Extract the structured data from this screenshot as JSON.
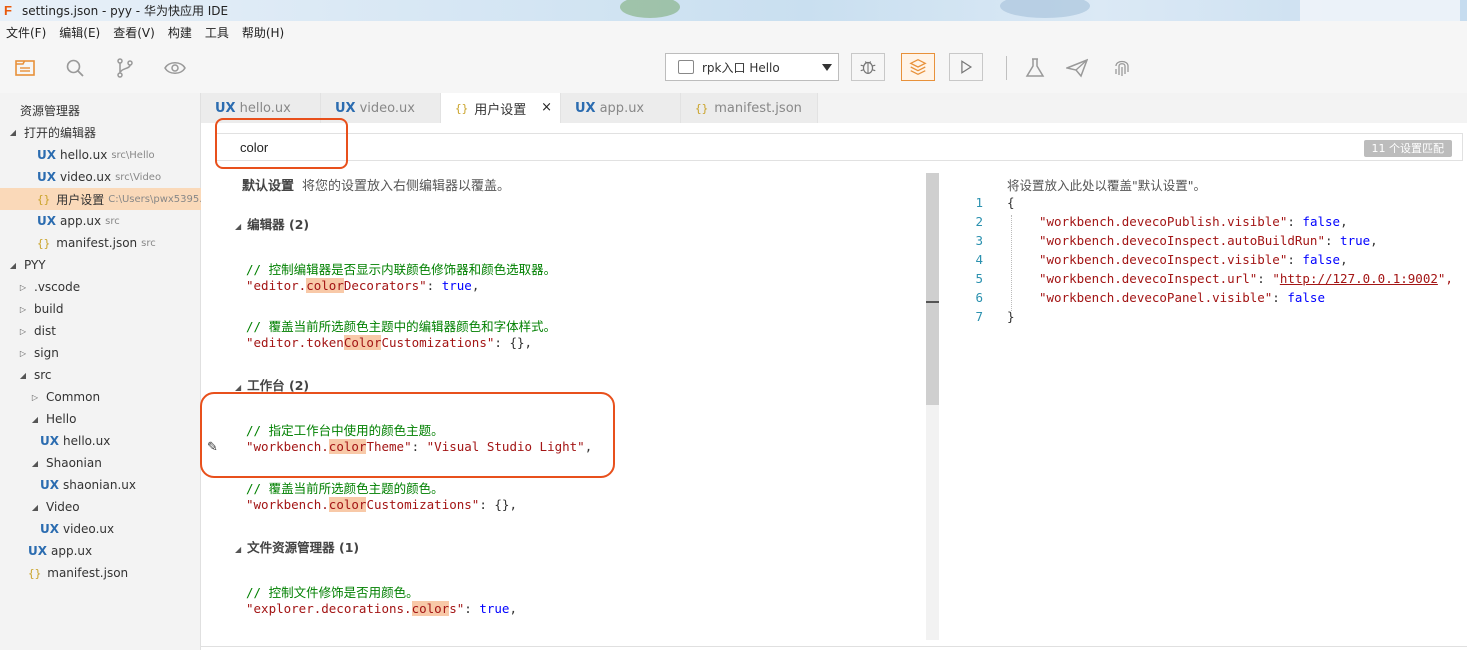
{
  "window": {
    "title": "settings.json - pyy - 华为快应用 IDE",
    "app_icon": "F"
  },
  "menu": [
    "文件(F)",
    "编辑(E)",
    "查看(V)",
    "构建",
    "工具",
    "帮助(H)"
  ],
  "toolbar": {
    "left_icons": [
      "explorer-icon",
      "search-icon",
      "source-control-icon",
      "preview-eye-icon"
    ],
    "run_config": "rpk入口 Hello",
    "right_icons": [
      "debug-bug-icon",
      "layers-icon",
      "run-play-icon",
      "flask-icon",
      "send-icon",
      "fingerprint-icon"
    ]
  },
  "sidebar": {
    "rows": [
      {
        "label": "资源管理器"
      },
      {
        "label": "打开的编辑器"
      },
      {
        "label": "hello.ux",
        "path": "src\\Hello"
      },
      {
        "label": "video.ux",
        "path": "src\\Video"
      },
      {
        "label": "用户设置",
        "path": "C:\\Users\\pwx5395..."
      },
      {
        "label": "app.ux",
        "path": "src"
      },
      {
        "label": "manifest.json",
        "path": "src"
      },
      {
        "label": "PYY"
      },
      {
        "label": ".vscode"
      },
      {
        "label": "build"
      },
      {
        "label": "dist"
      },
      {
        "label": "sign"
      },
      {
        "label": "src"
      },
      {
        "label": "Common"
      },
      {
        "label": "Hello"
      },
      {
        "label": "hello.ux"
      },
      {
        "label": "Shaonian"
      },
      {
        "label": "shaonian.ux"
      },
      {
        "label": "Video"
      },
      {
        "label": "video.ux"
      },
      {
        "label": "app.ux"
      },
      {
        "label": "manifest.json"
      }
    ],
    "ux_badge": "UX",
    "json_badge": "{}"
  },
  "tabs": [
    {
      "label": "hello.ux"
    },
    {
      "label": "video.ux"
    },
    {
      "label": "用户设置",
      "close": "×"
    },
    {
      "label": "app.ux"
    },
    {
      "label": "manifest.json"
    }
  ],
  "search": {
    "value": "color",
    "match_count": "11 个设置匹配"
  },
  "defaults_pane": {
    "title": "默认设置",
    "subtitle": "将您的设置放入右侧编辑器以覆盖。",
    "sections": [
      {
        "name": "编辑器 (2)"
      },
      {
        "name": "工作台 (2)"
      },
      {
        "name": "文件资源管理器 (1)"
      }
    ],
    "lines": {
      "c1": "// 控制编辑器是否显示内联颜色修饰器和颜色选取器。",
      "k1a": "\"editor.",
      "k1h": "color",
      "k1b": "Decorators\"",
      "v1": "true",
      "c2": "// 覆盖当前所选颜色主题中的编辑器颜色和字体样式。",
      "k2a": "\"editor.token",
      "k2h": "Color",
      "k2b": "Customizations\"",
      "v2": "{}",
      "c3": "// 指定工作台中使用的颜色主题。",
      "k3a": "\"workbench.",
      "k3h": "color",
      "k3b": "Theme\"",
      "v3": "\"Visual Studio Light\"",
      "c4": "// 覆盖当前所选颜色主题的颜色。",
      "k4a": "\"workbench.",
      "k4h": "color",
      "k4b": "Customizations\"",
      "v4": "{}",
      "c5": "// 控制文件修饰是否用颜色。",
      "k5a": "\"explorer.decorations.",
      "k5h": "color",
      "k5b": "s\"",
      "v5": "true"
    }
  },
  "user_pane": {
    "hint": "将设置放入此处以覆盖\"默认设置\"。",
    "line_numbers": [
      "1",
      "2",
      "3",
      "4",
      "5",
      "6",
      "7"
    ],
    "entries": [
      {
        "key": "\"workbench.devecoPublish.visible\"",
        "value": "false",
        "tail": ","
      },
      {
        "key": "\"workbench.devecoInspect.autoBuildRun\"",
        "value": "true",
        "tail": ","
      },
      {
        "key": "\"workbench.devecoInspect.visible\"",
        "value": "false",
        "tail": ","
      },
      {
        "key": "\"workbench.devecoInspect.url\"",
        "value": "http://127.0.0.1:9002",
        "tail": "\","
      },
      {
        "key": "\"workbench.devecoPanel.visible\"",
        "value": "false",
        "tail": ""
      }
    ],
    "open_brace": "{",
    "close_brace": "}"
  },
  "colors": {
    "accent": "#e8913a",
    "highlight_box": "#e8501c",
    "selection": "#fad9b9",
    "ux_badge": "#2b6cb0"
  }
}
